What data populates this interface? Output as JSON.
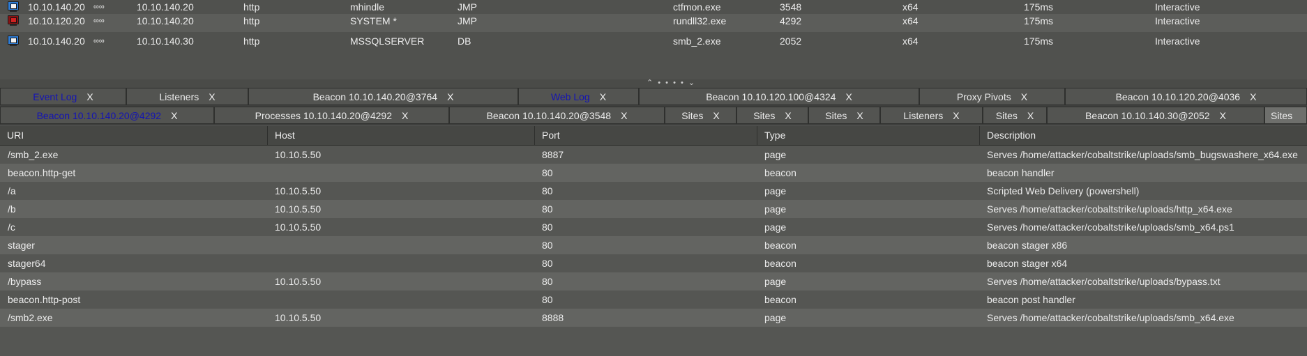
{
  "beacons": [
    {
      "external": "10.10.140.20",
      "pivot": "∞∞",
      "internal": "10.10.140.20",
      "listener": "http",
      "user": "mhindle",
      "computer": "JMP",
      "process": "ctfmon.exe",
      "pid": "3548",
      "arch": "x64",
      "last": "175ms",
      "note": "Interactive",
      "icon": "monitor-blue-icon"
    },
    {
      "external": "10.10.120.20",
      "pivot": "∞∞",
      "internal": "10.10.140.20",
      "listener": "http",
      "user": "SYSTEM *",
      "computer": "JMP",
      "process": "rundll32.exe",
      "pid": "4292",
      "arch": "x64",
      "last": "175ms",
      "note": "Interactive",
      "icon": "monitor-red-icon"
    },
    {
      "external": "10.10.140.20",
      "pivot": "∞∞",
      "internal": "10.10.140.30",
      "listener": "http",
      "user": "MSSQLSERVER",
      "computer": "DB",
      "process": "smb_2.exe",
      "pid": "2052",
      "arch": "x64",
      "last": "175ms",
      "note": "Interactive",
      "icon": "monitor-blue-icon"
    }
  ],
  "splitter": "⌃ • • • • ⌄",
  "tabs_row1": [
    {
      "label": "Event Log",
      "close": "X",
      "highlight": true
    },
    {
      "label": "Listeners",
      "close": "X"
    },
    {
      "label": "Beacon 10.10.140.20@3764",
      "close": "X"
    },
    {
      "label": "Web Log",
      "close": "X",
      "highlight": true
    },
    {
      "label": "Beacon 10.10.120.100@4324",
      "close": "X"
    },
    {
      "label": "Proxy Pivots",
      "close": "X"
    },
    {
      "label": "Beacon 10.10.120.20@4036",
      "close": "X"
    }
  ],
  "tabs_row2": [
    {
      "label": "Beacon 10.10.140.20@4292",
      "close": "X",
      "highlight": true
    },
    {
      "label": "Processes 10.10.140.20@4292",
      "close": "X"
    },
    {
      "label": "Beacon 10.10.140.20@3548",
      "close": "X"
    },
    {
      "label": "Sites",
      "close": "X"
    },
    {
      "label": "Sites",
      "close": "X"
    },
    {
      "label": "Sites",
      "close": "X"
    },
    {
      "label": "Listeners",
      "close": "X"
    },
    {
      "label": "Sites",
      "close": "X"
    },
    {
      "label": "Beacon 10.10.140.30@2052",
      "close": "X"
    },
    {
      "label": "Sites",
      "close": "",
      "active": true
    }
  ],
  "sites": {
    "columns": [
      "URI",
      "Host",
      "Port",
      "Type",
      "Description"
    ],
    "rows": [
      {
        "uri": "/smb_2.exe",
        "host": "10.10.5.50",
        "port": "8887",
        "type": "page",
        "desc": "Serves /home/attacker/cobaltstrike/uploads/smb_bugswashere_x64.exe"
      },
      {
        "uri": "beacon.http-get",
        "host": "",
        "port": "80",
        "type": "beacon",
        "desc": "beacon handler"
      },
      {
        "uri": "/a",
        "host": "10.10.5.50",
        "port": "80",
        "type": "page",
        "desc": "Scripted Web Delivery (powershell)"
      },
      {
        "uri": "/b",
        "host": "10.10.5.50",
        "port": "80",
        "type": "page",
        "desc": "Serves /home/attacker/cobaltstrike/uploads/http_x64.exe"
      },
      {
        "uri": "/c",
        "host": "10.10.5.50",
        "port": "80",
        "type": "page",
        "desc": "Serves /home/attacker/cobaltstrike/uploads/smb_x64.ps1"
      },
      {
        "uri": "stager",
        "host": "",
        "port": "80",
        "type": "beacon",
        "desc": "beacon stager x86"
      },
      {
        "uri": "stager64",
        "host": "",
        "port": "80",
        "type": "beacon",
        "desc": "beacon stager x64"
      },
      {
        "uri": "/bypass",
        "host": "10.10.5.50",
        "port": "80",
        "type": "page",
        "desc": "Serves /home/attacker/cobaltstrike/uploads/bypass.txt"
      },
      {
        "uri": "beacon.http-post",
        "host": "",
        "port": "80",
        "type": "beacon",
        "desc": "beacon post handler"
      },
      {
        "uri": "/smb2.exe",
        "host": "10.10.5.50",
        "port": "8888",
        "type": "page",
        "desc": "Serves /home/attacker/cobaltstrike/uploads/smb_x64.exe"
      }
    ]
  },
  "colors": {
    "highlight_tab_text": "#1414b4",
    "background": "#545552"
  }
}
